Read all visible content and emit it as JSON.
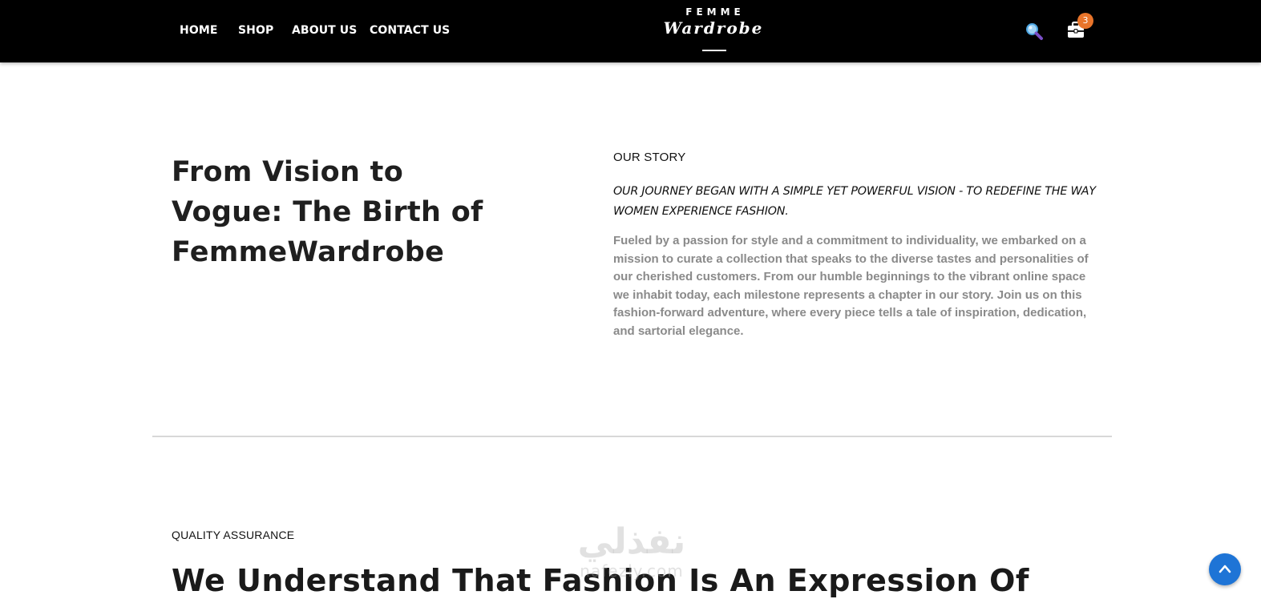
{
  "nav": {
    "links": [
      "HOME",
      "SHOP",
      "ABOUT US",
      "CONTACT US"
    ],
    "logo_top": "FEMME",
    "logo_main": "Wardrobe",
    "cart_count": "3"
  },
  "story": {
    "title": "From Vision to Vogue: The Birth of FemmeWardrobe",
    "label": "OUR STORY",
    "lead": "OUR JOURNEY BEGAN WITH A SIMPLE YET POWERFUL VISION - TO REDEFINE THE WAY WOMEN EXPERIENCE FASHION.",
    "body": "Fueled by a passion for style and a commitment to individuality, we embarked on a mission to curate a collection that speaks to the diverse tastes and personalities of our cherished customers. From our humble beginnings to the vibrant online space we inhabit today, each milestone represents a chapter in our story. Join us on this fashion-forward adventure, where every piece tells a tale of inspiration, dedication, and sartorial elegance."
  },
  "quality": {
    "label": "QUALITY ASSURANCE",
    "heading": "We Understand That Fashion Is An Expression Of"
  },
  "watermark": {
    "arabic": "نفذلي",
    "latin": "nafezly.com"
  },
  "colors": {
    "nav_bg": "#000000",
    "badge": "#e8742a",
    "scroll_top": "#1e74d6",
    "body_text_muted": "#8a8a8a"
  },
  "icons": [
    "search-icon",
    "cart-icon",
    "arrow-up-icon"
  ]
}
